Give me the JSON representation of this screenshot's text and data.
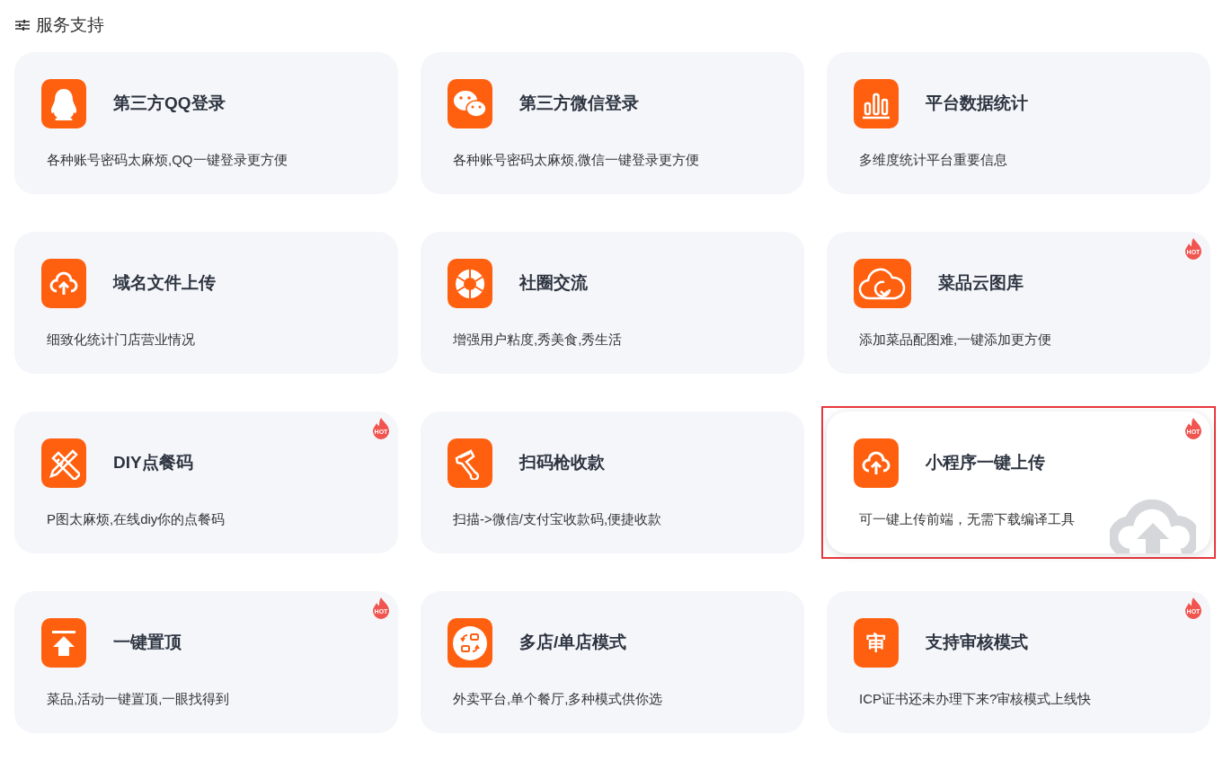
{
  "section": {
    "title": "服务支持"
  },
  "cards": [
    {
      "title": "第三方QQ登录",
      "description": "各种账号密码太麻烦,QQ一键登录更方便",
      "selected": false
    },
    {
      "title": "第三方微信登录",
      "description": "各种账号密码太麻烦,微信一键登录更方便",
      "selected": false
    },
    {
      "title": "平台数据统计",
      "description": "多维度统计平台重要信息",
      "selected": false
    },
    {
      "title": "域名文件上传",
      "description": "细致化统计门店营业情况",
      "selected": false
    },
    {
      "title": "社圈交流",
      "description": "增强用户粘度,秀美食,秀生活",
      "selected": false
    },
    {
      "title": "菜品云图库",
      "description": "添加菜品配图难,一键添加更方便",
      "hot_badge": "HOT",
      "selected": false
    },
    {
      "title": "DIY点餐码",
      "description": "P图太麻烦,在线diy你的点餐码",
      "hot_badge": "HOT",
      "selected": false
    },
    {
      "title": "扫码枪收款",
      "description": "扫描->微信/支付宝收款码,便捷收款",
      "selected": false
    },
    {
      "title": "小程序一键上传",
      "description": "可一键上传前端，无需下载编译工具",
      "hot_badge": "HOT",
      "selected": true
    },
    {
      "title": "一键置顶",
      "description": "菜品,活动一键置顶,一眼找得到",
      "hot_badge": "HOT",
      "selected": false
    },
    {
      "title": "多店/单店模式",
      "description": "外卖平台,单个餐厅,多种模式供你选",
      "selected": false
    },
    {
      "title": "支持审核模式",
      "description": "ICP证书还未办理下来?审核模式上线快",
      "hot_badge": "HOT",
      "icon_glyph": "审",
      "selected": false
    }
  ]
}
